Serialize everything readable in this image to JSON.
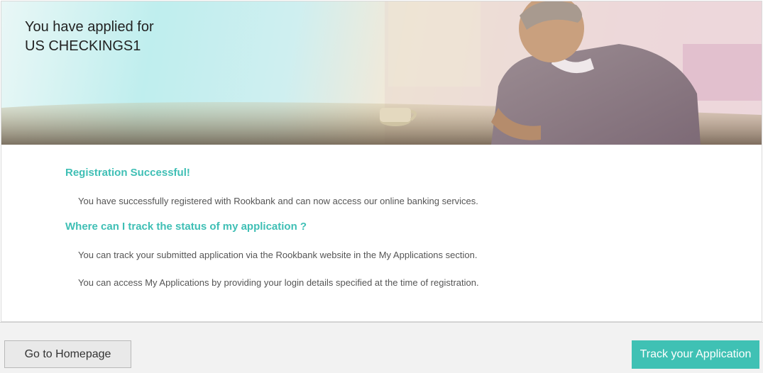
{
  "banner": {
    "title_line1": "You have applied for",
    "title_line2": "US CHECKINGS1"
  },
  "messages": {
    "heading_success": "Registration Successful!",
    "text_success": "You have successfully registered with Rookbank and can now access our online banking services.",
    "heading_track": "Where can I track the status of my application ?",
    "text_track_1": "You can track your submitted application via the Rookbank website in the My Applications section.",
    "text_track_2": "You can access My Applications by providing your login details specified at the time of registration."
  },
  "footer": {
    "home_label": "Go to Homepage",
    "track_label": "Track your Application"
  },
  "colors": {
    "accent": "#3fc1b4",
    "heading": "#3fbfb5"
  }
}
